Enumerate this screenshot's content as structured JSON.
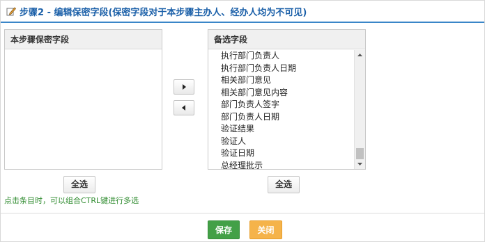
{
  "header": {
    "title": "步骤2 - 编辑保密字段(保密字段对于本步骤主办人、经办人均为不可见)",
    "icon": "edit-icon"
  },
  "left_panel": {
    "title": "本步骤保密字段",
    "items": []
  },
  "right_panel": {
    "title": "备选字段",
    "items": [
      "执行部门负责人",
      "执行部门负责人日期",
      "相关部门意见",
      "相关部门意见内容",
      "部门负责人签字",
      "部门负责人日期",
      "验证结果",
      "验证人",
      "验证日期",
      "总经理批示"
    ]
  },
  "move_buttons": {
    "right_icon": "triangle-right-icon",
    "left_icon": "triangle-left-icon"
  },
  "select_all_left": "全选",
  "select_all_right": "全选",
  "hint": "点击条目时，可以组合CTRL键进行多选",
  "footer": {
    "save_label": "保存",
    "close_label": "关闭"
  },
  "colors": {
    "title": "#1a5fa8",
    "header_line": "#3a86c8",
    "hint": "#2e8b2e",
    "save": "#43a047",
    "close": "#f5b34a"
  }
}
